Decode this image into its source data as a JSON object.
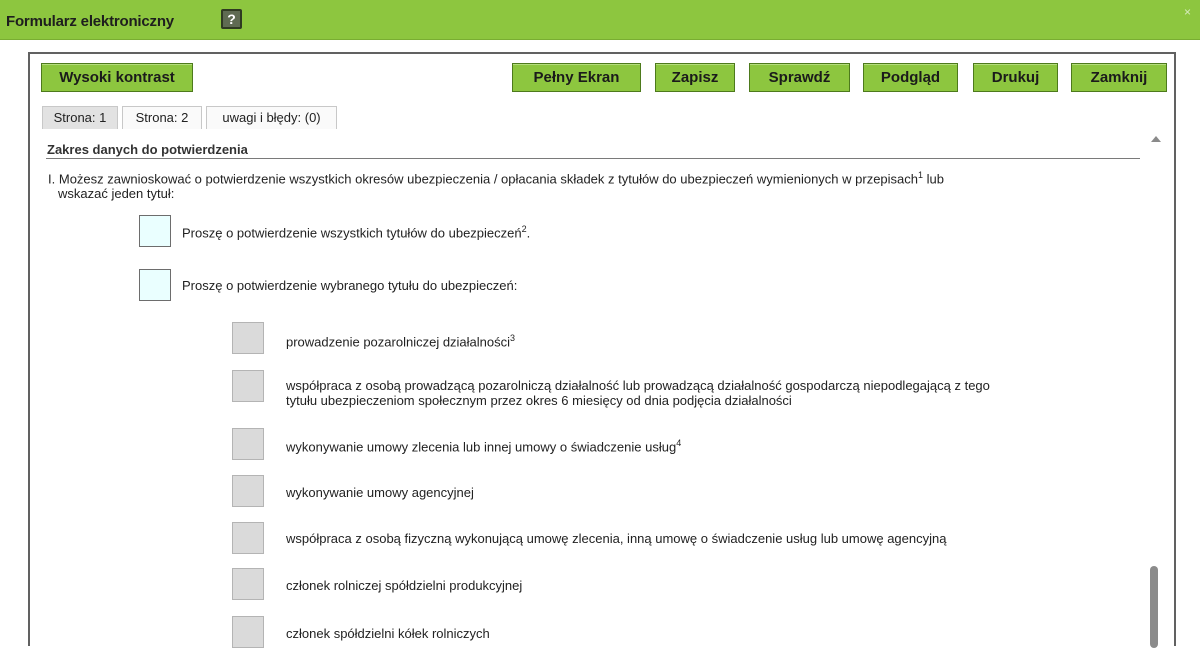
{
  "window": {
    "title": "Formularz elektroniczny",
    "help_glyph": "?",
    "close_glyph": "×"
  },
  "toolbar": {
    "contrast": "Wysoki kontrast",
    "fullscreen": "Pełny Ekran",
    "save": "Zapisz",
    "check": "Sprawdź",
    "preview": "Podgląd",
    "print": "Drukuj",
    "close": "Zamknij"
  },
  "tabs": [
    {
      "label": "Strona: 1",
      "active": true
    },
    {
      "label": "Strona: 2",
      "active": false
    },
    {
      "label": "uwagi i błędy: (0)",
      "active": false
    }
  ],
  "section": {
    "title": "Zakres danych do potwierdzenia",
    "intro_prefix": "I.",
    "intro_text": "Możesz zawnioskować o potwierdzenie wszystkich okresów ubezpieczenia / opłacania składek z tytułów do ubezpieczeń wymienionych w przepisach",
    "intro_sup": "1",
    "intro_tail": " lub",
    "intro_line2": "wskazać jeden tytuł:"
  },
  "main_options": [
    {
      "text": "Proszę o potwierdzenie wszystkich tytułów do ubezpieczeń",
      "sup": "2",
      "tail": "."
    },
    {
      "text": "Proszę o potwierdzenie wybranego tytułu do ubezpieczeń:",
      "sup": "",
      "tail": ""
    }
  ],
  "sub_options": [
    {
      "text": "prowadzenie pozarolniczej działalności",
      "sup": "3"
    },
    {
      "text": "współpraca z osobą prowadzącą pozarolniczą działalność lub prowadzącą działalność gospodarczą niepodlegającą z tego",
      "line2": "tytułu ubezpieczeniom społecznym przez okres 6 miesięcy od dnia podjęcia działalności",
      "sup": ""
    },
    {
      "text": "wykonywanie umowy zlecenia lub innej umowy o świadczenie usług",
      "sup": "4"
    },
    {
      "text": "wykonywanie umowy agencyjnej",
      "sup": ""
    },
    {
      "text": "współpraca z osobą fizyczną wykonującą umowę zlecenia, inną umowę o świadczenie usług lub umowę agencyjną",
      "sup": ""
    },
    {
      "text": "członek rolniczej spółdzielni produkcyjnej",
      "sup": ""
    },
    {
      "text": "członek spółdzielni kółek rolniczych",
      "sup": ""
    }
  ],
  "colors": {
    "accent": "#8dc63f",
    "main_checkbox_fill": "#eaffff",
    "sub_checkbox_fill": "#dadada"
  }
}
